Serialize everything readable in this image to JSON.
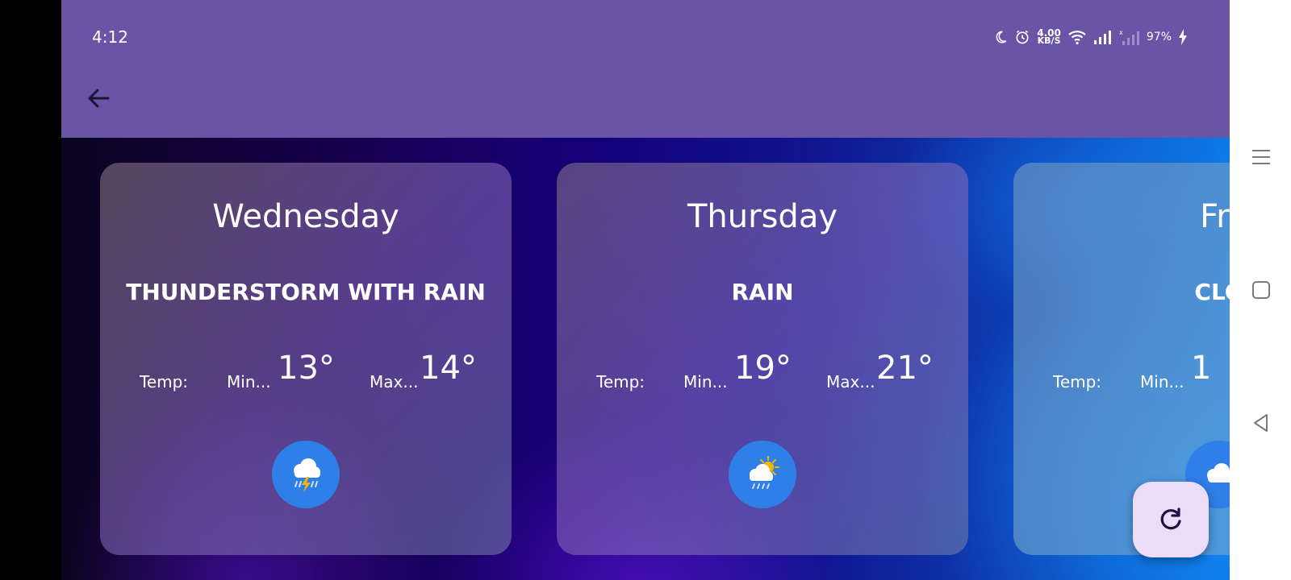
{
  "status_bar": {
    "time": "4:12",
    "speed_value": "4.00",
    "speed_unit": "KB/S",
    "battery": "97%"
  },
  "colors": {
    "appbar": "#6a54a6",
    "icon_circle": "#2f7fe8",
    "fab": "#ecdcfa"
  },
  "labels": {
    "temp": "Temp:",
    "min": "Min...",
    "max": "Max..."
  },
  "forecast": [
    {
      "day": "Wednesday",
      "condition": "THUNDERSTORM WITH RAIN",
      "min": "13°",
      "max": "14°",
      "icon": "thunderstorm-icon"
    },
    {
      "day": "Thursday",
      "condition": "RAIN",
      "min": "19°",
      "max": "21°",
      "icon": "sun-rain-icon"
    },
    {
      "day": "Fri",
      "condition": "CLO",
      "min": "1",
      "icon": "cloud-icon"
    }
  ],
  "icons": {
    "back": "arrow-left-icon",
    "refresh": "refresh-icon",
    "nav": [
      "menu-icon",
      "home-square-icon",
      "back-triangle-icon"
    ]
  }
}
